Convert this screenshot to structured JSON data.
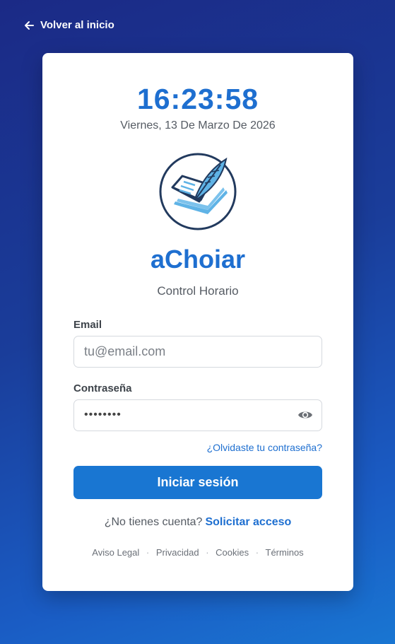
{
  "nav": {
    "back_label": "Volver al inicio"
  },
  "clock": {
    "time": "16:23:58",
    "date": "Viernes, 13 De Marzo De 2026"
  },
  "brand": {
    "name": "aChoiar",
    "subtitle": "Control Horario"
  },
  "form": {
    "email_label": "Email",
    "email_placeholder": "tu@email.com",
    "password_label": "Contraseña",
    "password_masked": "••••••••",
    "forgot_link": "¿Olvidaste tu contraseña?",
    "submit_label": "Iniciar sesión"
  },
  "signup": {
    "prompt": "¿No tienes cuenta?",
    "link": "Solicitar acceso"
  },
  "footer": {
    "links": [
      "Aviso Legal",
      "Privacidad",
      "Cookies",
      "Términos"
    ],
    "separator": "·"
  },
  "colors": {
    "accent": "#1976d2",
    "brand_text": "#1e6fd0",
    "logo_ring": "#223a5e",
    "logo_light": "#5fb3e6"
  },
  "icons": {
    "back": "arrow-left-icon",
    "logo": "book-quill-icon",
    "eye": "eye-icon"
  }
}
